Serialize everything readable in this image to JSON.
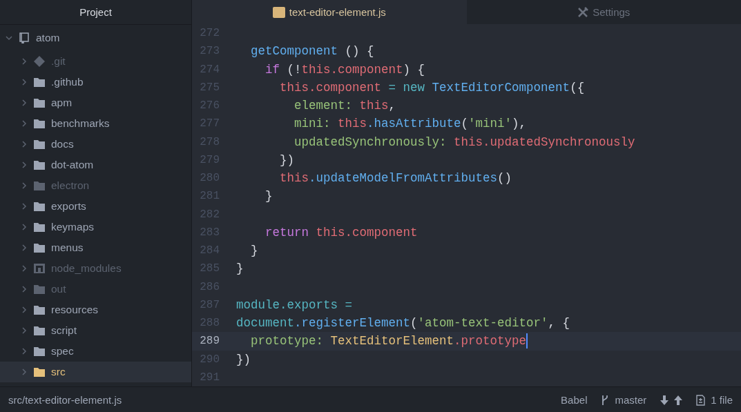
{
  "sidebar": {
    "title": "Project",
    "tree": {
      "name": "atom",
      "kind": "repo",
      "expanded": true,
      "children": [
        {
          "name": ".git",
          "kind": "git",
          "dimmed": true,
          "selected": false
        },
        {
          "name": ".github",
          "kind": "folder",
          "dimmed": false,
          "selected": false
        },
        {
          "name": "apm",
          "kind": "folder",
          "dimmed": false,
          "selected": false
        },
        {
          "name": "benchmarks",
          "kind": "folder",
          "dimmed": false,
          "selected": false
        },
        {
          "name": "docs",
          "kind": "folder",
          "dimmed": false,
          "selected": false
        },
        {
          "name": "dot-atom",
          "kind": "folder",
          "dimmed": false,
          "selected": false
        },
        {
          "name": "electron",
          "kind": "folder",
          "dimmed": true,
          "selected": false
        },
        {
          "name": "exports",
          "kind": "folder",
          "dimmed": false,
          "selected": false
        },
        {
          "name": "keymaps",
          "kind": "folder",
          "dimmed": false,
          "selected": false
        },
        {
          "name": "menus",
          "kind": "folder",
          "dimmed": false,
          "selected": false
        },
        {
          "name": "node_modules",
          "kind": "package",
          "dimmed": true,
          "selected": false
        },
        {
          "name": "out",
          "kind": "folder",
          "dimmed": true,
          "selected": false
        },
        {
          "name": "resources",
          "kind": "folder",
          "dimmed": false,
          "selected": false
        },
        {
          "name": "script",
          "kind": "folder",
          "dimmed": false,
          "selected": false
        },
        {
          "name": "spec",
          "kind": "folder",
          "dimmed": false,
          "selected": false
        },
        {
          "name": "src",
          "kind": "folder",
          "dimmed": false,
          "selected": true
        }
      ]
    }
  },
  "tabs": [
    {
      "label": "text-editor-element.js",
      "kind": "file",
      "selected": true
    },
    {
      "label": "Settings",
      "kind": "settings",
      "selected": false
    }
  ],
  "editor": {
    "lines": [
      {
        "number": "272",
        "current": false
      },
      {
        "number": "273",
        "current": false,
        "tokens": [
          {
            "text": "  getComponent",
            "kind": "fn"
          },
          {
            "text": " () {",
            "kind": "punct"
          }
        ]
      },
      {
        "number": "274",
        "current": false,
        "tokens": [
          {
            "text": "    if",
            "kind": "keyword"
          },
          {
            "text": " (!",
            "kind": "punct"
          },
          {
            "text": "this",
            "kind": "this"
          },
          {
            "text": ".component",
            "kind": "prop"
          },
          {
            "text": ") {",
            "kind": "punct"
          }
        ]
      },
      {
        "number": "275",
        "current": false,
        "tokens": [
          {
            "text": "      this",
            "kind": "this"
          },
          {
            "text": ".component",
            "kind": "prop"
          },
          {
            "text": " = new",
            "kind": "operator"
          },
          {
            "text": " TextEditorComponent",
            "kind": "fn"
          },
          {
            "text": "({",
            "kind": "punct"
          }
        ]
      },
      {
        "number": "276",
        "current": false,
        "tokens": [
          {
            "text": "        element:",
            "kind": "key"
          },
          {
            "text": " this",
            "kind": "this"
          },
          {
            "text": ",",
            "kind": "punct"
          }
        ]
      },
      {
        "number": "277",
        "current": false,
        "tokens": [
          {
            "text": "        mini:",
            "kind": "key"
          },
          {
            "text": " this",
            "kind": "this"
          },
          {
            "text": ".hasAttribute",
            "kind": "fn"
          },
          {
            "text": "(",
            "kind": "punct"
          },
          {
            "text": "'mini'",
            "kind": "string"
          },
          {
            "text": "),",
            "kind": "punct"
          }
        ]
      },
      {
        "number": "278",
        "current": false,
        "tokens": [
          {
            "text": "        updatedSynchronously:",
            "kind": "key"
          },
          {
            "text": " this",
            "kind": "this"
          },
          {
            "text": ".updatedSynchronously",
            "kind": "prop"
          }
        ]
      },
      {
        "number": "279",
        "current": false,
        "tokens": [
          {
            "text": "      })",
            "kind": "punct"
          }
        ]
      },
      {
        "number": "280",
        "current": false,
        "tokens": [
          {
            "text": "      this",
            "kind": "this"
          },
          {
            "text": ".updateModelFromAttributes",
            "kind": "fn"
          },
          {
            "text": "()",
            "kind": "punct"
          }
        ]
      },
      {
        "number": "281",
        "current": false,
        "tokens": [
          {
            "text": "    }",
            "kind": "punct"
          }
        ]
      },
      {
        "number": "282",
        "current": false
      },
      {
        "number": "283",
        "current": false,
        "tokens": [
          {
            "text": "    return",
            "kind": "keyword"
          },
          {
            "text": " this",
            "kind": "this"
          },
          {
            "text": ".component",
            "kind": "prop"
          }
        ]
      },
      {
        "number": "284",
        "current": false,
        "tokens": [
          {
            "text": "  }",
            "kind": "punct"
          }
        ]
      },
      {
        "number": "285",
        "current": false,
        "tokens": [
          {
            "text": "}",
            "kind": "punct"
          }
        ]
      },
      {
        "number": "286",
        "current": false
      },
      {
        "number": "287",
        "current": false,
        "tokens": [
          {
            "text": "module.exports =",
            "kind": "operator"
          }
        ]
      },
      {
        "number": "288",
        "current": false,
        "tokens": [
          {
            "text": "document",
            "kind": "operator"
          },
          {
            "text": ".registerElement",
            "kind": "fn"
          },
          {
            "text": "(",
            "kind": "punct"
          },
          {
            "text": "'atom-text-editor'",
            "kind": "string"
          },
          {
            "text": ", {",
            "kind": "punct"
          }
        ]
      },
      {
        "number": "289",
        "current": true,
        "tokens": [
          {
            "text": "  prototype:",
            "kind": "key"
          },
          {
            "text": " TextEditorElement",
            "kind": "class"
          },
          {
            "text": ".prototype",
            "kind": "prop"
          }
        ]
      },
      {
        "number": "290",
        "current": false,
        "tokens": [
          {
            "text": "})",
            "kind": "punct"
          }
        ]
      },
      {
        "number": "291",
        "current": false
      }
    ]
  },
  "status_bar": {
    "path": "src/text-editor-element.js",
    "grammar": "Babel",
    "branch": "master",
    "changes": "1 file"
  }
}
